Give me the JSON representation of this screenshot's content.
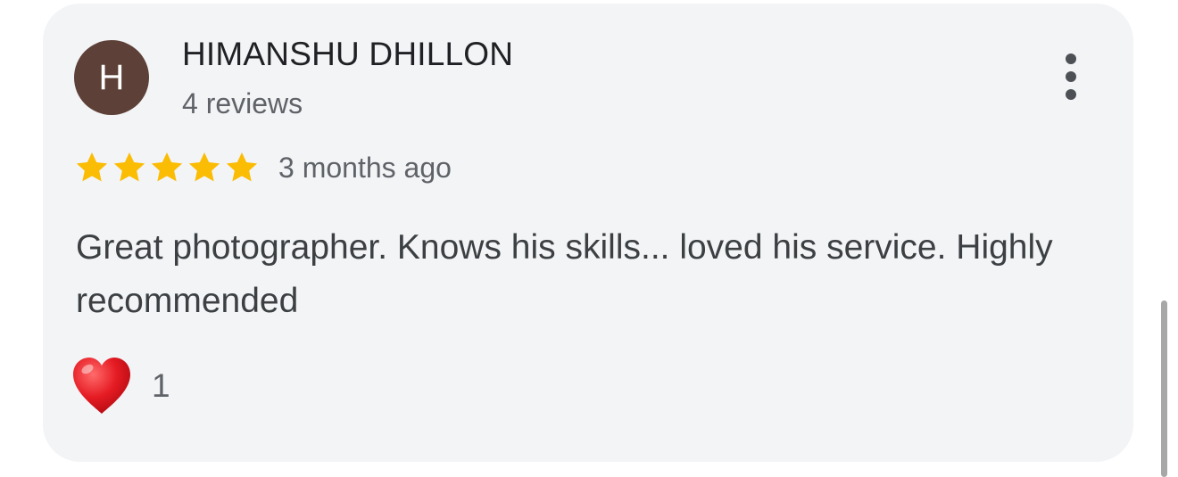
{
  "review": {
    "avatar_letter": "H",
    "avatar_color": "#5d4037",
    "reviewer_name": "HIMANSHU DHILLON",
    "review_count": "4 reviews",
    "rating": 5,
    "rating_max": 5,
    "star_color": "#fbbc04",
    "time_ago": "3 months ago",
    "text": "Great photographer. Knows his skills... loved his service. Highly recommended",
    "reaction_icon": "heart-icon",
    "reaction_count": "1",
    "menu_icon": "more-vert-icon"
  }
}
